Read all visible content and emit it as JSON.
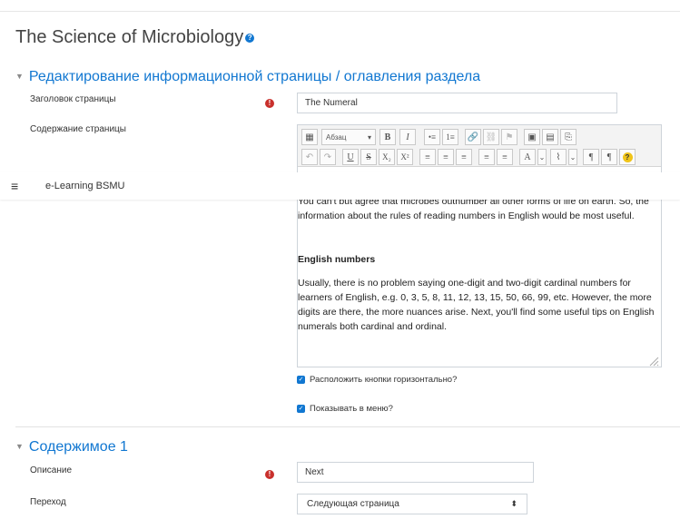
{
  "page": {
    "title": "The Science of Microbiology",
    "help_glyph": "?"
  },
  "section_edit": {
    "heading": "Редактирование информационной страницы / оглавления раздела",
    "page_title_label": "Заголовок страницы",
    "page_title_value": "The Numeral",
    "content_label": "Содержание страницы"
  },
  "editor": {
    "paragraph_select": "Абзац",
    "toolbar_row1": [
      "B",
      "I",
      "•≡",
      "1≡",
      "🔗",
      "⛓",
      "⚑",
      "▣",
      "▤",
      "⎘"
    ],
    "toolbar_row2": [
      "↶",
      "↷",
      "U",
      "S",
      "X₂",
      "X²",
      "≡",
      "≡",
      "≡",
      "≡",
      "≡",
      "A",
      "⌄",
      "⌇",
      "⌄",
      "¶",
      "¶",
      "?"
    ],
    "content": {
      "paragraph1": "You can't but agree that microbes outnumber all other forms of life on earth. So, the information about the rules of reading numbers in English would be most useful.",
      "heading": "English numbers",
      "paragraph2": "Usually, there is no problem saying one-digit and two-digit cardinal numbers for learners of English, e.g. 0, 3, 5, 8, 11, 12, 13, 15, 50, 66, 99, etc. However, the more digits are there, the more nuances arise. Next, you'll find some useful tips on English numerals both cardinal and ordinal."
    }
  },
  "nav": {
    "menu_icon": "≡",
    "site_name": "e-Learning BSMU"
  },
  "options": {
    "horizontal_buttons": "Расположить кнопки горизонтально?",
    "show_in_menu": "Показывать в меню?"
  },
  "section_content": {
    "heading": "Содержимое 1",
    "description_label": "Описание",
    "description_value": "Next",
    "jump_label": "Переход",
    "jump_value": "Следующая страница",
    "jump_arrow": "⬍"
  },
  "colors": {
    "accent": "#1177d1",
    "required": "#c9302c"
  },
  "icons": {
    "required": "!",
    "check": "✓",
    "chevron": "▼"
  }
}
